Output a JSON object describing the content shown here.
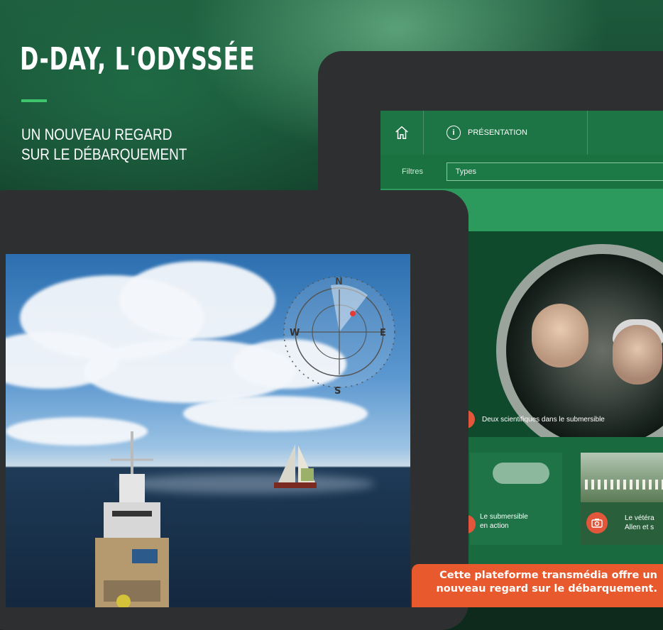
{
  "header": {
    "title": "D-DAY, L'ODYSSÉE",
    "subtitle_line1": "UN NOUVEAU REGARD",
    "subtitle_line2": "SUR LE DÉBARQUEMENT"
  },
  "back_tablet": {
    "nav": {
      "home_icon": "home-icon",
      "tab_info_icon": "info-icon",
      "tab_label": "PRÉSENTATION"
    },
    "filters": {
      "label": "Filtres",
      "select_value": "Types"
    },
    "feature_caption": "Deux scientifiques dans le submersible",
    "cards": [
      {
        "line1": "Le submersible",
        "line2": "en action"
      },
      {
        "line1": "Le vétéra",
        "line2": "Allen et s",
        "icon": "camera-icon"
      }
    ]
  },
  "front_tablet": {
    "compass": {
      "n": "N",
      "s": "S",
      "e": "E",
      "w": "W"
    }
  },
  "callout": {
    "line1": "Cette plateforme transmédia offre un",
    "line2": "nouveau regard sur le débarquement."
  },
  "colors": {
    "accent_green": "#3fc56b",
    "nav_green": "#1d7545",
    "orange": "#e85a2e"
  }
}
